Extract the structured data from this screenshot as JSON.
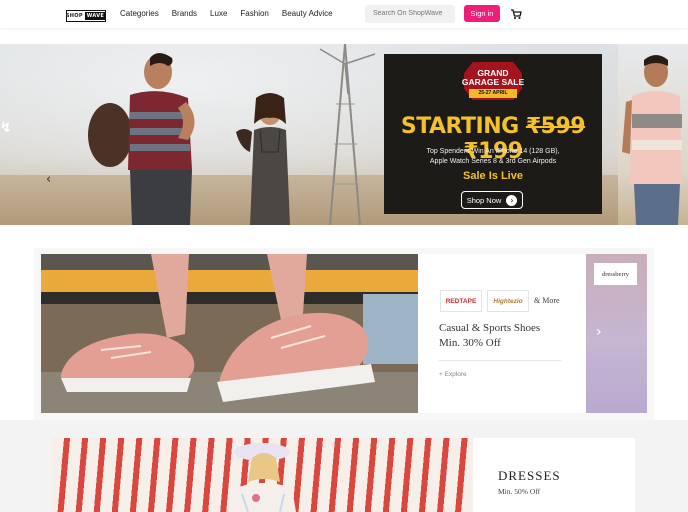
{
  "header": {
    "logo_left": "SHOP",
    "logo_right": "WAVE",
    "nav": [
      "Categories",
      "Brands",
      "Luxe",
      "Fashion",
      "Beauty Advice"
    ],
    "search_placeholder": "Search On ShopWave",
    "signin_label": "Sign in",
    "cart_icon": "cart-icon"
  },
  "hero": {
    "badge_line1": "GRAND",
    "badge_line2": "GARAGE SALE",
    "badge_date": "25-27 APRIL",
    "starting_label": "STARTING",
    "old_price": "₹599",
    "new_price": "₹199",
    "line1": "Top Spenders Win An iPhone 14 (128 GB),",
    "line2": "Apple Watch Series 8 & 3rd Gen Airpods",
    "live_label": "Sale Is Live",
    "cta_label": "Shop Now",
    "prev_glyph": "‹"
  },
  "shoe_offer": {
    "brand1": "REDTAPE",
    "brand2": "Hightezio",
    "more_label": "& More",
    "title": "Casual & Sports Shoes",
    "subtitle": "Min. 30% Off",
    "explore_label": "+ Explore",
    "next_brand": "dressberry",
    "next_glyph": "›"
  },
  "dress_offer": {
    "title": "DRESSES",
    "subtitle": "Min. 50% Off"
  },
  "colors": {
    "accent": "#ed1f76",
    "promo_gold": "#f4c12d",
    "promo_bg": "#1d1b18"
  }
}
